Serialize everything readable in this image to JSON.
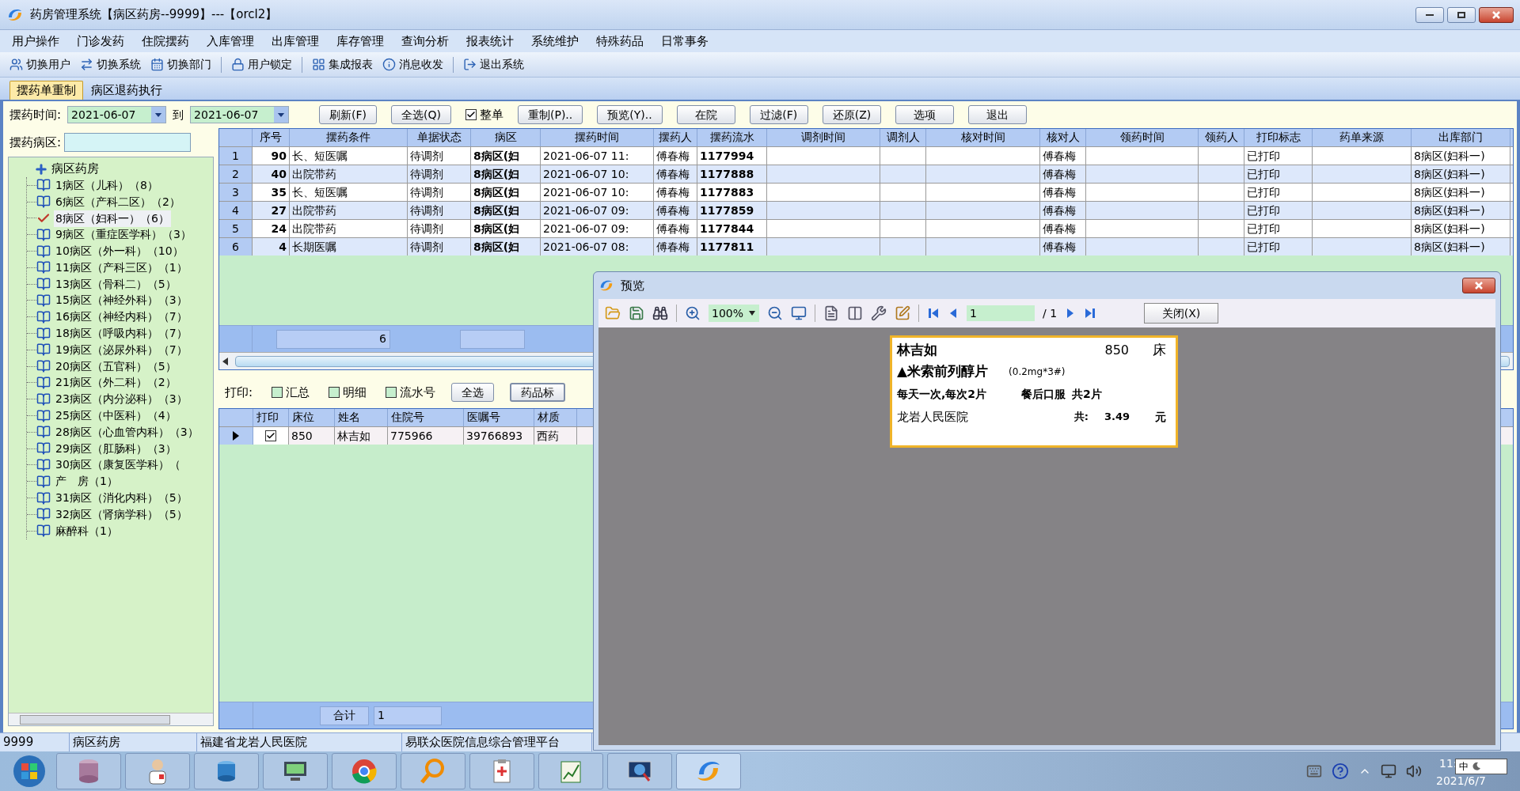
{
  "window": {
    "title": "药房管理系统【病区药房--9999】---【orcl2】"
  },
  "menu": [
    "用户操作",
    "门诊发药",
    "住院摆药",
    "入库管理",
    "出库管理",
    "库存管理",
    "查询分析",
    "报表统计",
    "系统维护",
    "特殊药品",
    "日常事务"
  ],
  "toolbar": [
    {
      "label": "切换用户",
      "kind": "users"
    },
    {
      "label": "切换系统",
      "kind": "switch"
    },
    {
      "label": "切换部门",
      "kind": "calendar"
    },
    {
      "label": "用户锁定",
      "kind": "lock"
    },
    {
      "label": "集成报表",
      "kind": "grid"
    },
    {
      "label": "消息收发",
      "kind": "info"
    },
    {
      "label": "退出系统",
      "kind": "exit"
    }
  ],
  "tabs": [
    {
      "label": "摆药单重制",
      "selected": true
    },
    {
      "label": "病区退药执行",
      "selected": false
    }
  ],
  "filter": {
    "label": "摆药时间:",
    "from": "2021-06-07",
    "to_label": "到",
    "to": "2021-06-07",
    "items": [
      {
        "kind": "button",
        "label": "刷新(F)"
      },
      {
        "kind": "button",
        "label": "全选(Q)"
      },
      {
        "kind": "checkbox",
        "label": "整单",
        "checked": true
      },
      {
        "kind": "button",
        "label": "重制(P).."
      },
      {
        "kind": "button",
        "label": "预览(Y).."
      },
      {
        "kind": "button",
        "label": "在院"
      },
      {
        "kind": "button",
        "label": "过滤(F)"
      },
      {
        "kind": "button",
        "label": "还原(Z)"
      },
      {
        "kind": "button",
        "label": "选项"
      },
      {
        "kind": "button",
        "label": "退出"
      }
    ]
  },
  "ward_filter": {
    "label": "摆药病区:"
  },
  "tree": {
    "root": "病区药房",
    "children": [
      {
        "label": "1病区（儿科）（8）",
        "selected": false
      },
      {
        "label": "6病区（产科二区）（2）",
        "selected": false
      },
      {
        "label": "8病区（妇科一）（6）",
        "selected": true
      },
      {
        "label": "9病区（重症医学科）（3）",
        "selected": false
      },
      {
        "label": "10病区（外一科）（10）",
        "selected": false
      },
      {
        "label": "11病区（产科三区）（1）",
        "selected": false
      },
      {
        "label": "13病区（骨科二）（5）",
        "selected": false
      },
      {
        "label": "15病区（神经外科）（3）",
        "selected": false
      },
      {
        "label": "16病区（神经内科）（7）",
        "selected": false
      },
      {
        "label": "18病区（呼吸内科）（7）",
        "selected": false
      },
      {
        "label": "19病区（泌尿外科）（7）",
        "selected": false
      },
      {
        "label": "20病区（五官科）（5）",
        "selected": false
      },
      {
        "label": "21病区（外二科）（2）",
        "selected": false
      },
      {
        "label": "23病区（内分泌科）（3）",
        "selected": false
      },
      {
        "label": "25病区（中医科）（4）",
        "selected": false
      },
      {
        "label": "28病区（心血管内科）（3）",
        "selected": false
      },
      {
        "label": "29病区（肛肠科）（3）",
        "selected": false
      },
      {
        "label": "30病区（康复医学科）（",
        "selected": false
      },
      {
        "label": "产　房（1）",
        "selected": false
      },
      {
        "label": "31病区（消化内科）（5）",
        "selected": false
      },
      {
        "label": "32病区（肾病学科）（5）",
        "selected": false
      },
      {
        "label": "麻醉科（1）",
        "selected": false
      }
    ]
  },
  "upper_grid": {
    "columns": [
      "",
      "序号",
      "摆药条件",
      "单据状态",
      "病区",
      "摆药时间",
      "摆药人",
      "摆药流水",
      "调剂时间",
      "调剂人",
      "核对时间",
      "核对人",
      "领药时间",
      "领药人",
      "打印标志",
      "药单来源",
      "出库部门"
    ],
    "rows": [
      [
        "1",
        "90",
        "长、短医嘱",
        "待调剂",
        "8病区(妇",
        "2021-06-07 11:",
        "傅春梅",
        "1177994",
        "",
        "",
        "",
        "傅春梅",
        "",
        "",
        "已打印",
        "",
        "8病区(妇科一)"
      ],
      [
        "2",
        "40",
        "出院带药",
        "待调剂",
        "8病区(妇",
        "2021-06-07 10:",
        "傅春梅",
        "1177888",
        "",
        "",
        "",
        "傅春梅",
        "",
        "",
        "已打印",
        "",
        "8病区(妇科一)"
      ],
      [
        "3",
        "35",
        "长、短医嘱",
        "待调剂",
        "8病区(妇",
        "2021-06-07 10:",
        "傅春梅",
        "1177883",
        "",
        "",
        "",
        "傅春梅",
        "",
        "",
        "已打印",
        "",
        "8病区(妇科一)"
      ],
      [
        "4",
        "27",
        "出院带药",
        "待调剂",
        "8病区(妇",
        "2021-06-07 09:",
        "傅春梅",
        "1177859",
        "",
        "",
        "",
        "傅春梅",
        "",
        "",
        "已打印",
        "",
        "8病区(妇科一)"
      ],
      [
        "5",
        "24",
        "出院带药",
        "待调剂",
        "8病区(妇",
        "2021-06-07 09:",
        "傅春梅",
        "1177844",
        "",
        "",
        "",
        "傅春梅",
        "",
        "",
        "已打印",
        "",
        "8病区(妇科一)"
      ],
      [
        "6",
        "4",
        "长期医嘱",
        "待调剂",
        "8病区(妇",
        "2021-06-07 08:",
        "傅春梅",
        "1177811",
        "",
        "",
        "",
        "傅春梅",
        "",
        "",
        "已打印",
        "",
        "8病区(妇科一)"
      ]
    ],
    "footer_count": "6"
  },
  "print_options": {
    "label": "打印:",
    "checks": [
      {
        "label": "汇总",
        "checked": false
      },
      {
        "label": "明细",
        "checked": false
      },
      {
        "label": "流水号",
        "checked": false
      }
    ],
    "buttons": [
      "全选",
      "药品标"
    ]
  },
  "lower_grid": {
    "columns": [
      "",
      "打印",
      "床位",
      "姓名",
      "住院号",
      "医嘱号",
      "材质"
    ],
    "rows": [
      {
        "selected": true,
        "checked": true,
        "cells": [
          "",
          "",
          "850",
          "林吉如",
          "775966",
          "39766893",
          "西药"
        ]
      }
    ],
    "footer_label": "合计",
    "footer_value": "1"
  },
  "preview": {
    "title": "预览",
    "zoom": "100%",
    "page": "1",
    "page_total": "/ 1",
    "close": "关闭(X)",
    "label": {
      "name": "林吉如",
      "bed": "850",
      "bed_unit": "床",
      "drug": "▲米索前列醇片",
      "spec": "(0.2mg*3#)",
      "dosage": "每天一次,每次2片",
      "usage": "餐后口服",
      "quantity": "共2片",
      "hospital": "龙岩人民医院",
      "total_label": "共:",
      "amount": "3.49",
      "currency": "元"
    }
  },
  "status_bar": [
    "9999",
    "病区药房",
    "福建省龙岩人民医院",
    "易联众医院信息综合管理平台"
  ],
  "taskbar": {
    "time": "11:",
    "date": "2021/6/7",
    "ime": "中"
  }
}
